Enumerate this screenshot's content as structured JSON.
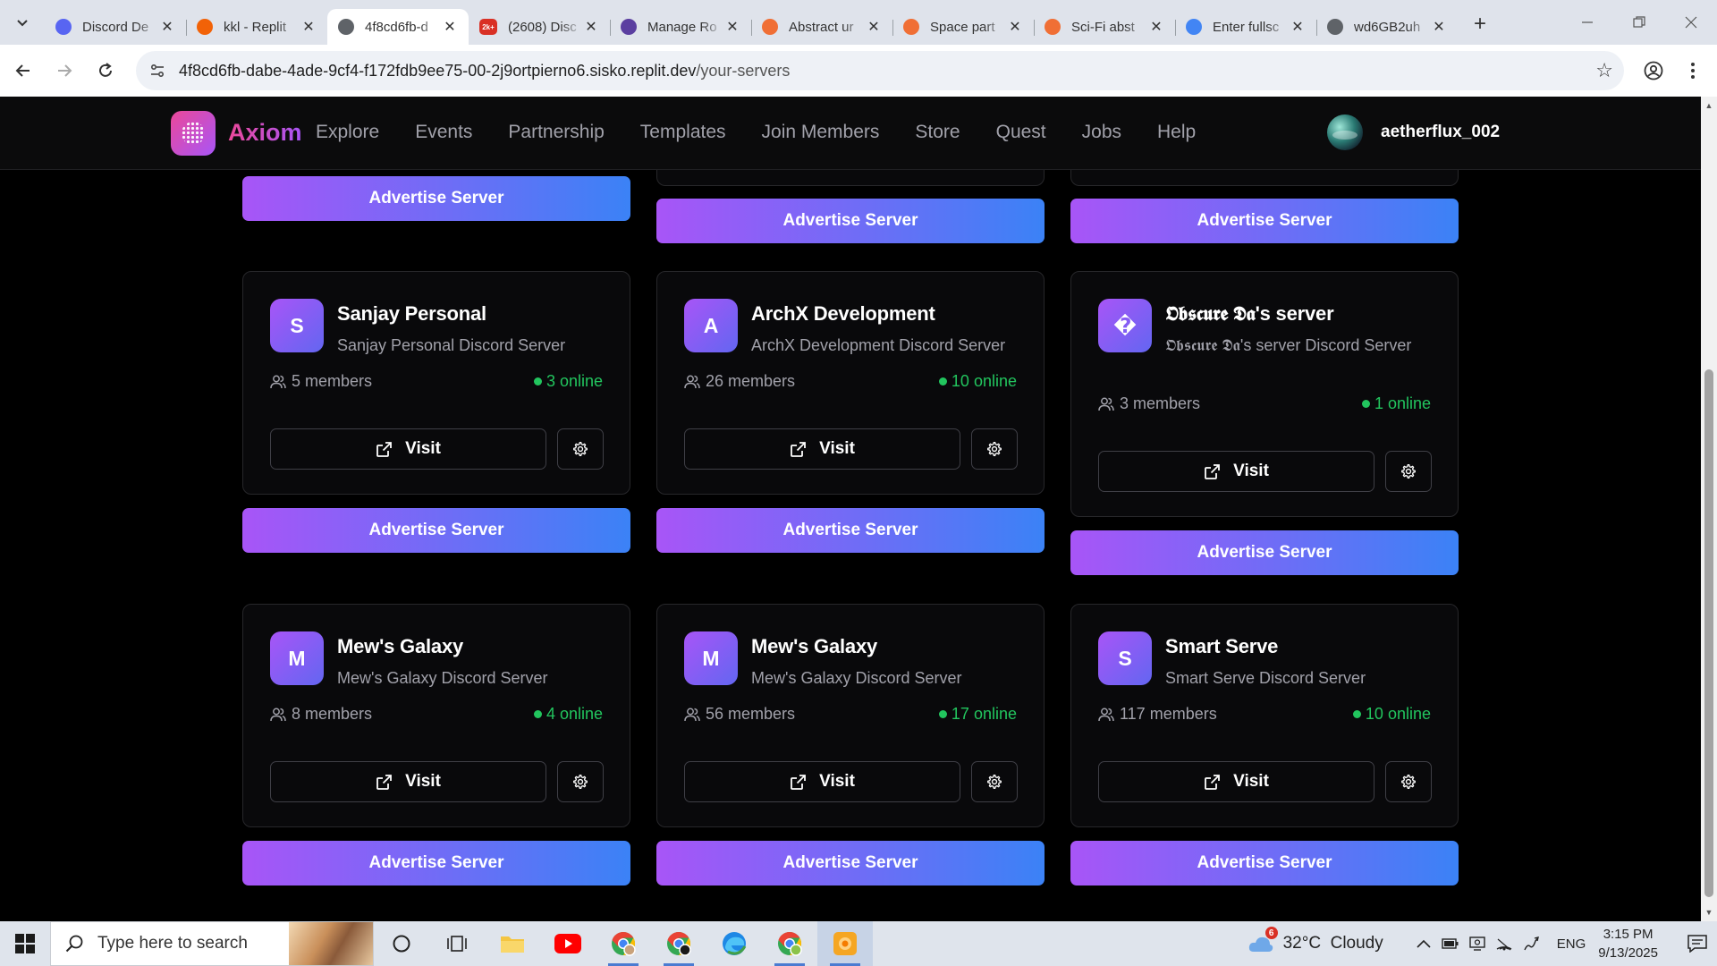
{
  "browser": {
    "tabs": [
      {
        "title": "Discord De",
        "favicon_color": "#5865F2",
        "favicon": "discord-icon"
      },
      {
        "title": "kkl - Replit",
        "favicon_color": "#F26207",
        "favicon": "replit-icon"
      },
      {
        "title": "4f8cd6fb-d",
        "favicon_color": "#5f6368",
        "favicon": "globe-icon",
        "active": true
      },
      {
        "title": "(2608) Disc",
        "favicon_color": "#d93025",
        "favicon": "notification-badge-icon",
        "badge": "2k+"
      },
      {
        "title": "Manage Ro",
        "favicon_color": "#5b3fa0",
        "favicon": "bot-icon"
      },
      {
        "title": "Abstract ur",
        "favicon_color": "#f06f35",
        "favicon": "brave-like-icon"
      },
      {
        "title": "Space part",
        "favicon_color": "#f06f35",
        "favicon": "brave-like-icon"
      },
      {
        "title": "Sci-Fi abst",
        "favicon_color": "#f06f35",
        "favicon": "brave-like-icon"
      },
      {
        "title": "Enter fullsc",
        "favicon_color": "#4285F4",
        "favicon": "google-icon"
      },
      {
        "title": "wd6GB2uh",
        "favicon_color": "#5f6368",
        "favicon": "globe-icon"
      }
    ],
    "url_host": "4f8cd6fb-dabe-4ade-9cf4-f172fdb9ee75-00-2j9ortpierno6.sisko.replit.dev",
    "url_path": "/your-servers"
  },
  "site": {
    "brand": "Axiom",
    "nav": [
      "Explore",
      "Events",
      "Partnership",
      "Templates",
      "Join Members",
      "Store",
      "Quest",
      "Jobs",
      "Help"
    ],
    "username": "aetherflux_002"
  },
  "labels": {
    "visit": "Visit",
    "advertise": "Advertise Server"
  },
  "servers": [
    {
      "initial": "S",
      "name": "Sanjay Personal",
      "description": "Sanjay Personal Discord Server",
      "members": "5 members",
      "online": "3 online"
    },
    {
      "initial": "A",
      "name": "ArchX Development",
      "description": "ArchX Development Discord Server",
      "members": "26 members",
      "online": "10 online"
    },
    {
      "initial": "�",
      "name": "𝕺𝖇𝖘𝖈𝖚𝖗𝖊 𝕯𝖆's server",
      "description": "𝕺𝖇𝖘𝖈𝖚𝖗𝖊 𝕯𝖆's server Discord Server",
      "members": "3 members",
      "online": "1 online"
    },
    {
      "initial": "M",
      "name": "Mew's Galaxy",
      "description": "Mew's Galaxy Discord Server",
      "members": "8 members",
      "online": "4 online"
    },
    {
      "initial": "M",
      "name": "Mew's Galaxy",
      "description": "Mew's Galaxy Discord Server",
      "members": "56 members",
      "online": "17 online"
    },
    {
      "initial": "S",
      "name": "Smart Serve",
      "description": "Smart Serve Discord Server",
      "members": "117 members",
      "online": "10 online"
    }
  ],
  "taskbar": {
    "search_placeholder": "Type here to search",
    "weather": "32°C  Cloudy",
    "weather_badge": "6",
    "lang": "ENG",
    "time": "3:15 PM",
    "date": "9/13/2025"
  }
}
